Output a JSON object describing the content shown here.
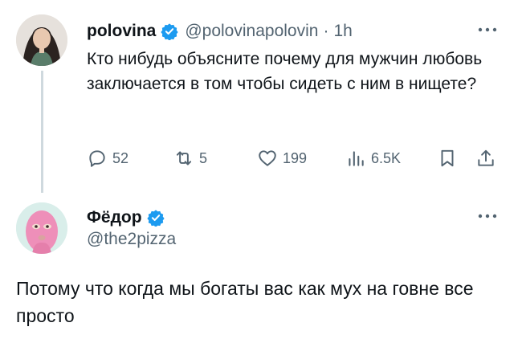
{
  "tweet1": {
    "author_name": "polovina",
    "handle": "@polovinapolovin",
    "time": "1h",
    "separator": "·",
    "text": "Кто нибудь объясните почему для мужчин любовь заключается в том чтобы сидеть с ним в нищете?",
    "actions": {
      "replies": "52",
      "reposts": "5",
      "likes": "199",
      "views": "6.5K"
    },
    "icons": [
      "verified-badge-icon",
      "more-icon",
      "reply-icon",
      "repost-icon",
      "like-icon",
      "views-icon",
      "bookmark-icon",
      "share-icon"
    ]
  },
  "tweet2": {
    "author_name": "Фёдор",
    "handle": "@the2pizza",
    "text": "Потому что когда мы богаты вас как мух на говне все просто",
    "icons": [
      "verified-badge-icon",
      "more-icon"
    ]
  },
  "colors": {
    "text": "#0f1419",
    "secondary": "#536471",
    "verified": "#1d9bf0",
    "thread_line": "#cfd9de"
  }
}
